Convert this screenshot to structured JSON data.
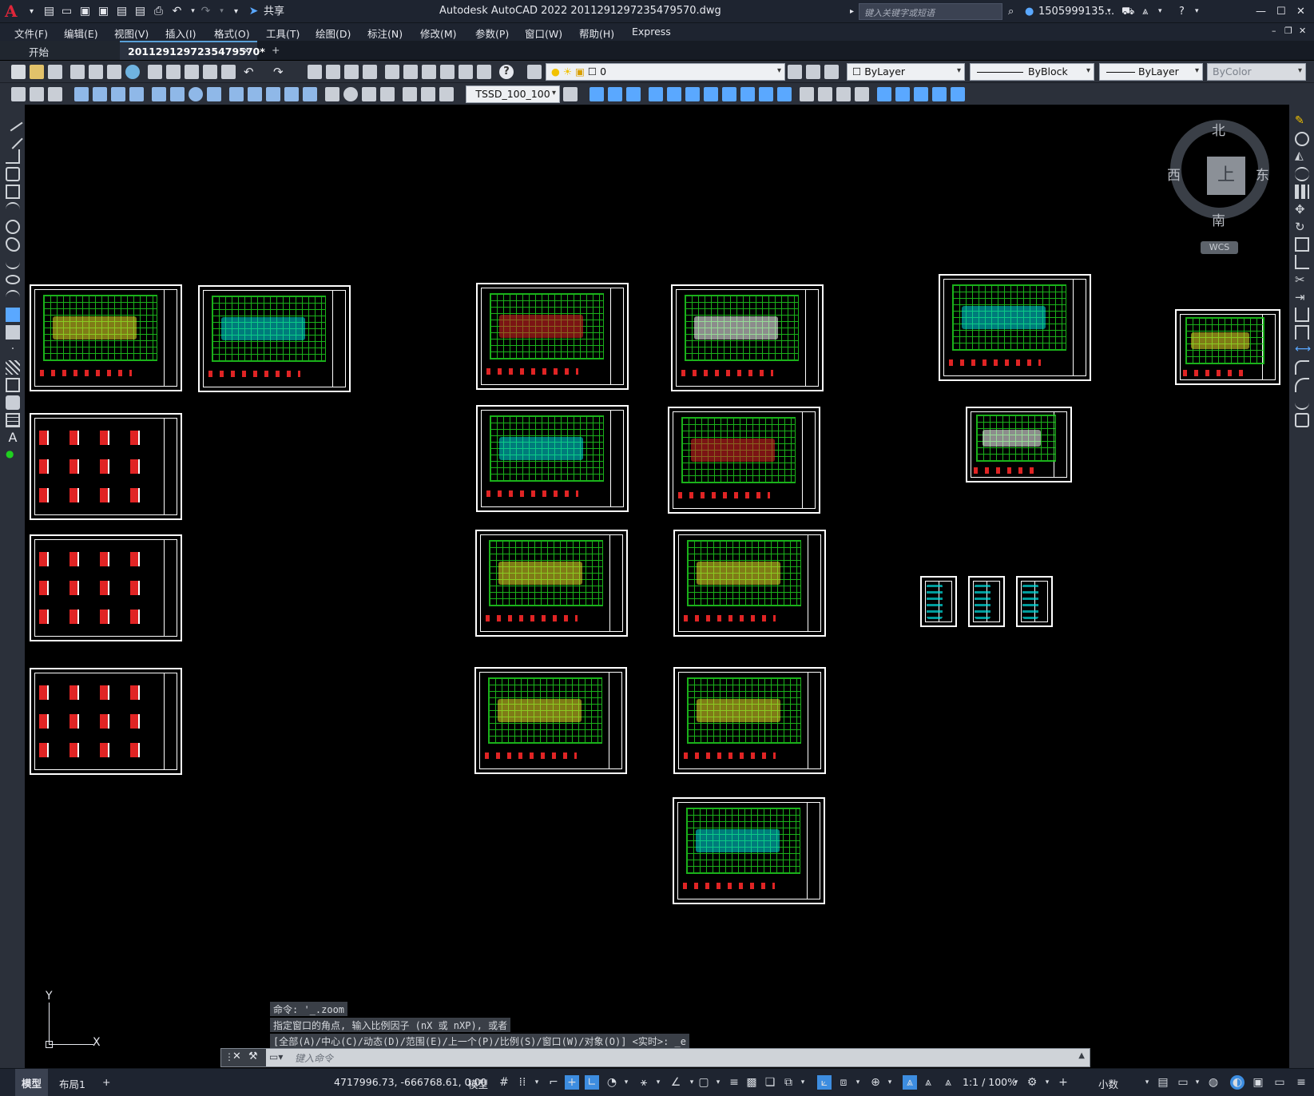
{
  "window": {
    "title": "Autodesk AutoCAD 2022    2011291297235479570.dwg",
    "share_label": "共享",
    "search_placeholder": "键入关键字或短语",
    "user": "1505999135...",
    "controls": [
      "—",
      "☐",
      "✕"
    ]
  },
  "menu": [
    "文件(F)",
    "编辑(E)",
    "视图(V)",
    "插入(I)",
    "格式(O)",
    "工具(T)",
    "绘图(D)",
    "标注(N)",
    "修改(M)",
    "参数(P)",
    "窗口(W)",
    "帮助(H)",
    "Express"
  ],
  "tabs": {
    "start": "开始",
    "document": "2011291297235479570*"
  },
  "toolbar": {
    "layer": "0",
    "color": "ByLayer",
    "linetype": "ByBlock",
    "lineweight": "ByLayer",
    "plotstyle": "ByColor",
    "dimstyle": "TSSD_100_100"
  },
  "viewcube": {
    "north": "北",
    "south": "南",
    "east": "东",
    "west": "西",
    "top": "上",
    "wcs": "WCS"
  },
  "ucs": {
    "x": "X",
    "y": "Y"
  },
  "command": {
    "history": [
      "命令: '_.zoom",
      "指定窗口的角点, 输入比例因子 (nX 或 nXP), 或者",
      "[全部(A)/中心(C)/动态(D)/范围(E)/上一个(P)/比例(S)/窗口(W)/对象(O)] <实时>: _e"
    ],
    "placeholder": "键入命令"
  },
  "layout_tabs": [
    "模型",
    "布局1",
    "+"
  ],
  "status": {
    "coords": "4717996.73, -666768.61, 0.00",
    "model": "模型",
    "scale": "1:1 / 100%",
    "units": "小数"
  }
}
